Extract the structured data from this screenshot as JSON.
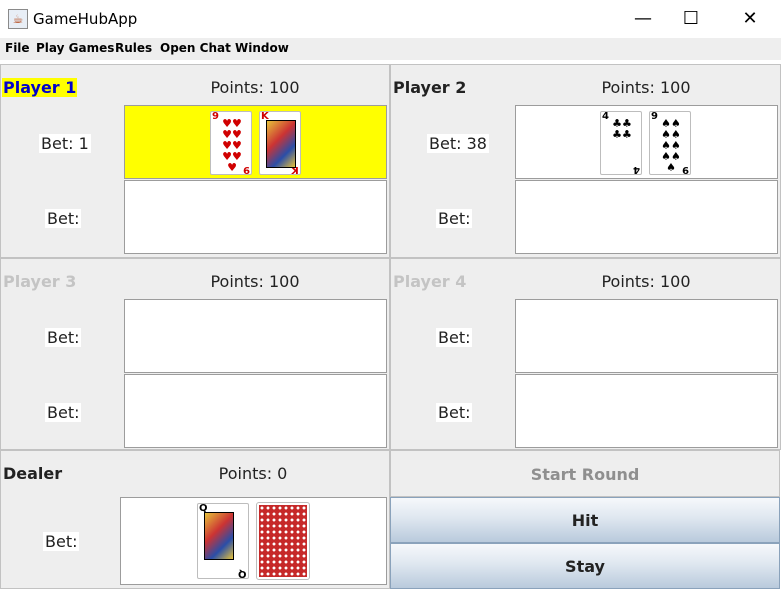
{
  "window": {
    "title": "GameHubApp",
    "app_icon": "java-cup-icon",
    "controls": {
      "minimize": "—",
      "maximize": "☐",
      "close": "✕"
    }
  },
  "menu": [
    "File",
    "Play Games",
    "Rules",
    "Open Chat Window"
  ],
  "players": [
    {
      "name": "Player 1",
      "points": "Points: 100",
      "bet1": "Bet: 1",
      "bet2": "Bet:",
      "active": true,
      "hand": [
        {
          "rank": "9",
          "suit": "♥",
          "color": "red",
          "kind": "pips"
        },
        {
          "rank": "K",
          "suit": "♦",
          "color": "red",
          "kind": "face"
        }
      ]
    },
    {
      "name": "Player 2",
      "points": "Points: 100",
      "bet1": "Bet: 38",
      "bet2": "Bet:",
      "active": false,
      "hand": [
        {
          "rank": "4",
          "suit": "♣",
          "color": "black",
          "kind": "pips"
        },
        {
          "rank": "9",
          "suit": "♠",
          "color": "black",
          "kind": "pips"
        }
      ]
    },
    {
      "name": "Player 3",
      "points": "Points: 100",
      "bet1": "Bet:",
      "bet2": "Bet:",
      "active": false,
      "hand": []
    },
    {
      "name": "Player 4",
      "points": "Points: 100",
      "bet1": "Bet:",
      "bet2": "Bet:",
      "active": false,
      "hand": []
    }
  ],
  "dealer": {
    "name": "Dealer",
    "points": "Points: 0",
    "bet": "Bet:",
    "hand": [
      {
        "rank": "Q",
        "suit": "♠",
        "color": "black",
        "kind": "face"
      },
      {
        "kind": "back",
        "color": "red"
      }
    ]
  },
  "buttons": {
    "start_round": "Start Round",
    "hit": "Hit",
    "stay": "Stay"
  },
  "colors": {
    "active_highlight": "#ffff00",
    "active_name_text": "#0000cc",
    "inactive_name_text": "#c4c4c4",
    "panel_bg": "#eeeeee"
  }
}
